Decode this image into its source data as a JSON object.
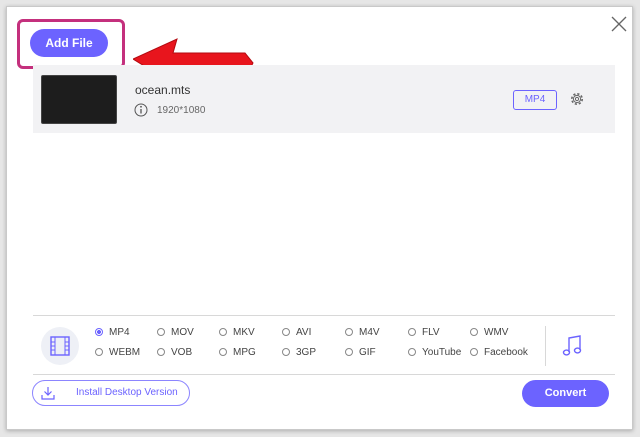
{
  "toolbar": {
    "add_file_label": "Add File"
  },
  "file": {
    "name": "ocean.mts",
    "resolution": "1920*1080",
    "output_format": "MP4"
  },
  "formats": {
    "selected": "MP4",
    "row1": [
      "MP4",
      "MOV",
      "MKV",
      "AVI",
      "M4V",
      "FLV",
      "WMV"
    ],
    "row2": [
      "WEBM",
      "VOB",
      "MPG",
      "3GP",
      "GIF",
      "YouTube",
      "Facebook"
    ]
  },
  "footer": {
    "install_label": "Install Desktop Version",
    "convert_label": "Convert"
  },
  "colors": {
    "accent": "#6c63ff",
    "highlight": "#c4307d",
    "arrow": "#e8151d"
  }
}
